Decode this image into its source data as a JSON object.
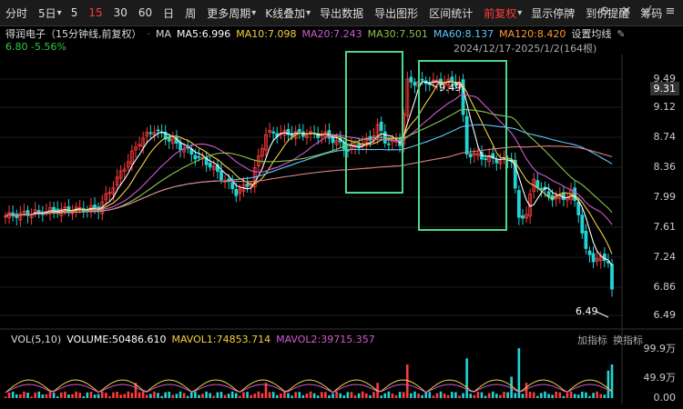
{
  "toolbar": {
    "items": [
      "分时",
      "5日",
      "5",
      "15",
      "30",
      "60",
      "日",
      "周",
      "更多周期",
      "K线叠加",
      "导出数据",
      "导出图形",
      "区间统计",
      "前复权",
      "显示停牌",
      "到价提醒",
      "筹码"
    ],
    "active_index": 3,
    "carets": [
      "",
      "▾",
      "",
      "",
      "",
      "",
      "",
      "",
      "▾",
      "▾",
      "",
      "",
      "",
      "▾",
      "",
      "",
      ""
    ]
  },
  "title_row": {
    "stock": "得润电子（15分钟线,前复权）",
    "ma_label": "MA",
    "ma5": "MA5:6.996",
    "ma10": "MA10:7.098",
    "ma20": "MA20:7.243",
    "ma30": "MA30:7.501",
    "ma60": "MA60:8.137",
    "ma120": "MA120:8.420",
    "settings": "设置均线"
  },
  "quote": {
    "price": "6.80",
    "change": "-5.56%"
  },
  "date_range": "2024/12/17-2025/1/2(164根)",
  "price_axis": [
    "9.49",
    "9.12",
    "8.74",
    "8.36",
    "7.99",
    "7.61",
    "7.24",
    "6.86",
    "6.49"
  ],
  "current_price_tag": "9.31",
  "annotations": {
    "high": "9.49",
    "low": "6.49"
  },
  "volume_row": {
    "label": "VOL(5,10)",
    "volume": "VOLUME:50486.610",
    "mavol1": "MAVOL1:74853.714",
    "mavol2": "MAVOL2:39715.357",
    "add_indicator": "加指标",
    "switch_indicator": "换指标"
  },
  "volume_axis": [
    "99.9万",
    "49.9万",
    "0.00"
  ],
  "colors": {
    "up": "#ff3b3b",
    "down": "#22d3d3",
    "ma5": "#ffffff",
    "ma10": "#f4d03f",
    "ma20": "#d05ad0",
    "ma30": "#8bc34a",
    "ma60": "#ff9933",
    "ma120": "#e08080",
    "box": "#4cd98a"
  }
}
